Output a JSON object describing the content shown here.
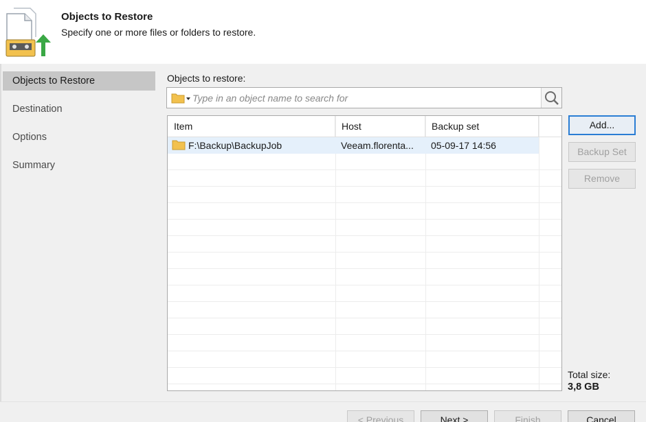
{
  "header": {
    "title": "Objects to Restore",
    "subtitle": "Specify one or more files or folders to restore.",
    "icon": "restore-files-icon"
  },
  "nav": {
    "items": [
      {
        "label": "Objects to Restore",
        "active": true
      },
      {
        "label": "Destination",
        "active": false
      },
      {
        "label": "Options",
        "active": false
      },
      {
        "label": "Summary",
        "active": false
      }
    ]
  },
  "objects": {
    "label": "Objects to restore:",
    "search_placeholder": "Type in an object name to search for",
    "search_value": ""
  },
  "table": {
    "columns": [
      "Item",
      "Host",
      "Backup set"
    ],
    "rows": [
      {
        "item": "F:\\Backup\\BackupJob",
        "host": "Veeam.florenta...",
        "backup_set": "05-09-17 14:56",
        "icon": "folder-icon",
        "selected": true
      }
    ]
  },
  "side_buttons": {
    "add": "Add...",
    "backup_set": "Backup Set",
    "remove": "Remove"
  },
  "total": {
    "label": "Total size:",
    "value": "3,8 GB"
  },
  "footer": {
    "previous": "< Previous",
    "next": "Next >",
    "finish": "Finish",
    "cancel": "Cancel"
  },
  "colors": {
    "accent": "#2a7dd4",
    "selected_row": "#e5f0fb",
    "nav_active": "#c6c6c6",
    "folder": "#f2c14e",
    "arrow": "#3aa845"
  }
}
